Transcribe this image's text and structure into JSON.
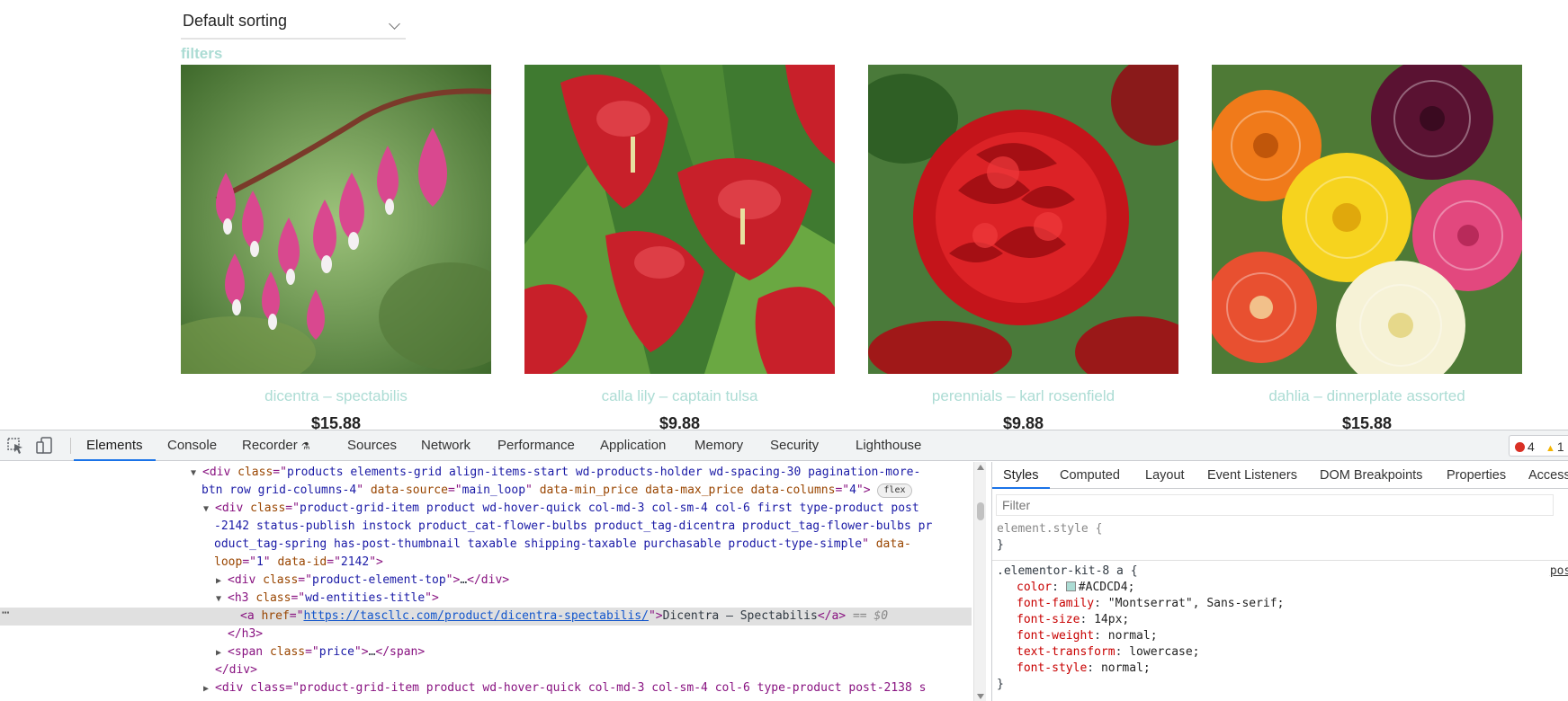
{
  "page": {
    "sort": {
      "label": "Default sorting"
    },
    "filters_label": "filters",
    "products": [
      {
        "title": "dicentra – spectabilis",
        "price": "$15.88"
      },
      {
        "title": "calla lily – captain tulsa",
        "price": "$9.88"
      },
      {
        "title": "perennials – karl rosenfield",
        "price": "$9.88"
      },
      {
        "title": "dahlia – dinnerplate assorted",
        "price": "$15.88"
      }
    ]
  },
  "devtools": {
    "tabs": [
      "Elements",
      "Console",
      "Recorder",
      "Sources",
      "Network",
      "Performance",
      "Application",
      "Memory",
      "Security",
      "Lighthouse"
    ],
    "active_tab": "Elements",
    "issues": {
      "errors": "4",
      "warnings": "1"
    },
    "dom": {
      "line1_a": "div",
      "line1_class": "products elements-grid align-items-start wd-products-holder  wd-spacing-30 pagination-more-",
      "line2_class": "btn row grid-columns-4",
      "line2_ds": "main_loop",
      "line2_cols": "4",
      "flex_badge": "flex",
      "line3_class": "product-grid-item product wd-hover-quick  col-md-3 col-sm-4 col-6 first  type-product post",
      "line4_text": "-2142 status-publish instock product_cat-flower-bulbs product_tag-dicentra product_tag-flower-bulbs pr",
      "line5_text": "oduct_tag-spring has-post-thumbnail taxable shipping-taxable purchasable product-type-simple",
      "line6_loop": "1",
      "line6_id": "2142",
      "line7_class": "product-element-top",
      "line8_class": "wd-entities-title",
      "link_href": "https://tascllc.com/product/dicentra-spectabilis/",
      "link_text": "Dicentra – Spectabilis",
      "eq0": "== $0",
      "price_class": "price",
      "last_line": "<div class=\"product-grid-item product wd-hover-quick  col-md-3 col-sm-4 col-6 type-product post-2138 s"
    },
    "styles": {
      "tabs": [
        "Styles",
        "Computed",
        "Layout",
        "Event Listeners",
        "DOM Breakpoints",
        "Properties",
        "Access"
      ],
      "active_tab": "Styles",
      "filter_placeholder": "Filter",
      "element_style": "element.style {",
      "close_brace": "}",
      "rule_selector": ".elementor-kit-8 a {",
      "rule_source": "post-",
      "props": [
        {
          "name": "color",
          "value": "#ACDCD4;"
        },
        {
          "name": "font-family",
          "value": "\"Montserrat\", Sans-serif;"
        },
        {
          "name": "font-size",
          "value": "14px;"
        },
        {
          "name": "font-weight",
          "value": "normal;"
        },
        {
          "name": "text-transform",
          "value": "lowercase;"
        },
        {
          "name": "font-style",
          "value": "normal;"
        }
      ],
      "swatch_color": "#ACDCD4"
    }
  }
}
